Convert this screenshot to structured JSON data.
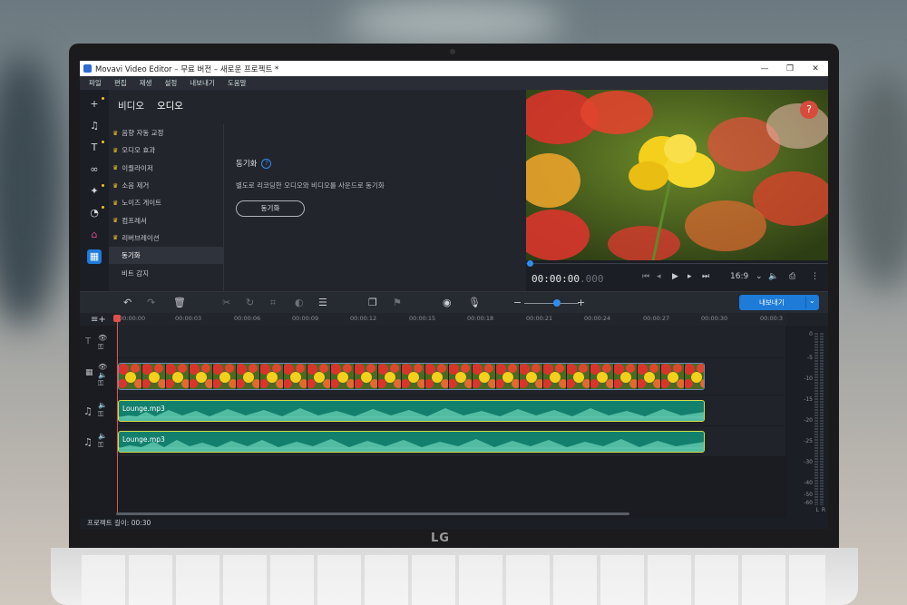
{
  "window": {
    "title": "Movavi Video Editor – 무료 버전 – 새로운 프로젝트 *",
    "minimize": "—",
    "maximize": "❐",
    "close": "✕"
  },
  "menu": [
    "파일",
    "편집",
    "재생",
    "설정",
    "내보내기",
    "도움말"
  ],
  "leftbar": {
    "icons": [
      "plus-icon",
      "music-note-icon",
      "text-icon",
      "transition-icon",
      "magic-wand-icon",
      "sticker-icon",
      "gift-icon",
      "apps-icon"
    ]
  },
  "panel": {
    "tabs": [
      "비디오",
      "오디오"
    ],
    "effects": [
      {
        "label": "음향 자동 교정",
        "premium": true
      },
      {
        "label": "오디오 효과",
        "premium": true
      },
      {
        "label": "이퀄라이저",
        "premium": true
      },
      {
        "label": "소음 제거",
        "premium": true
      },
      {
        "label": "노이즈 게이트",
        "premium": true
      },
      {
        "label": "컴프레서",
        "premium": true
      },
      {
        "label": "리버브레이션",
        "premium": true
      },
      {
        "label": "동기화",
        "premium": false,
        "selected": true
      },
      {
        "label": "비트 감지",
        "premium": false
      }
    ],
    "detail": {
      "title": "동기화",
      "help": "?",
      "description": "별도로 리코딩한 오디오와 비디오를 사운드로 동기화",
      "button": "동기화"
    }
  },
  "preview": {
    "help_badge": "?",
    "timecode_main": "00:00:00",
    "timecode_ms": ".000",
    "aspect_ratio": "16:9"
  },
  "toolbar": {
    "export_label": "내보내기",
    "export_caret": "⌄"
  },
  "ruler": {
    "ticks": [
      "00:00:00",
      "00:00:03",
      "00:00:06",
      "00:00:09",
      "00:00:12",
      "00:00:15",
      "00:00:18",
      "00:00:21",
      "00:00:24",
      "00:00:27",
      "00:00:30",
      "00:00:3"
    ]
  },
  "tracks": {
    "audio_clips": [
      {
        "name": "Lounge.mp3"
      },
      {
        "name": "Lounge.mp3"
      }
    ]
  },
  "meter": {
    "labels": [
      "0",
      "-5",
      "-10",
      "-15",
      "-20",
      "-25",
      "-30",
      "-40",
      "-50",
      "-60"
    ],
    "channels": [
      "L",
      "R"
    ]
  },
  "status": {
    "project_length": "프로젝트 길이: 00:30"
  },
  "brand": {
    "laptop_logo": "LG"
  },
  "colors": {
    "accent": "#1e7bd8",
    "premium_crown": "#f2c230",
    "playhead": "#e0504a",
    "audio_clip": "#13806e",
    "audio_border": "#d3e04a"
  }
}
